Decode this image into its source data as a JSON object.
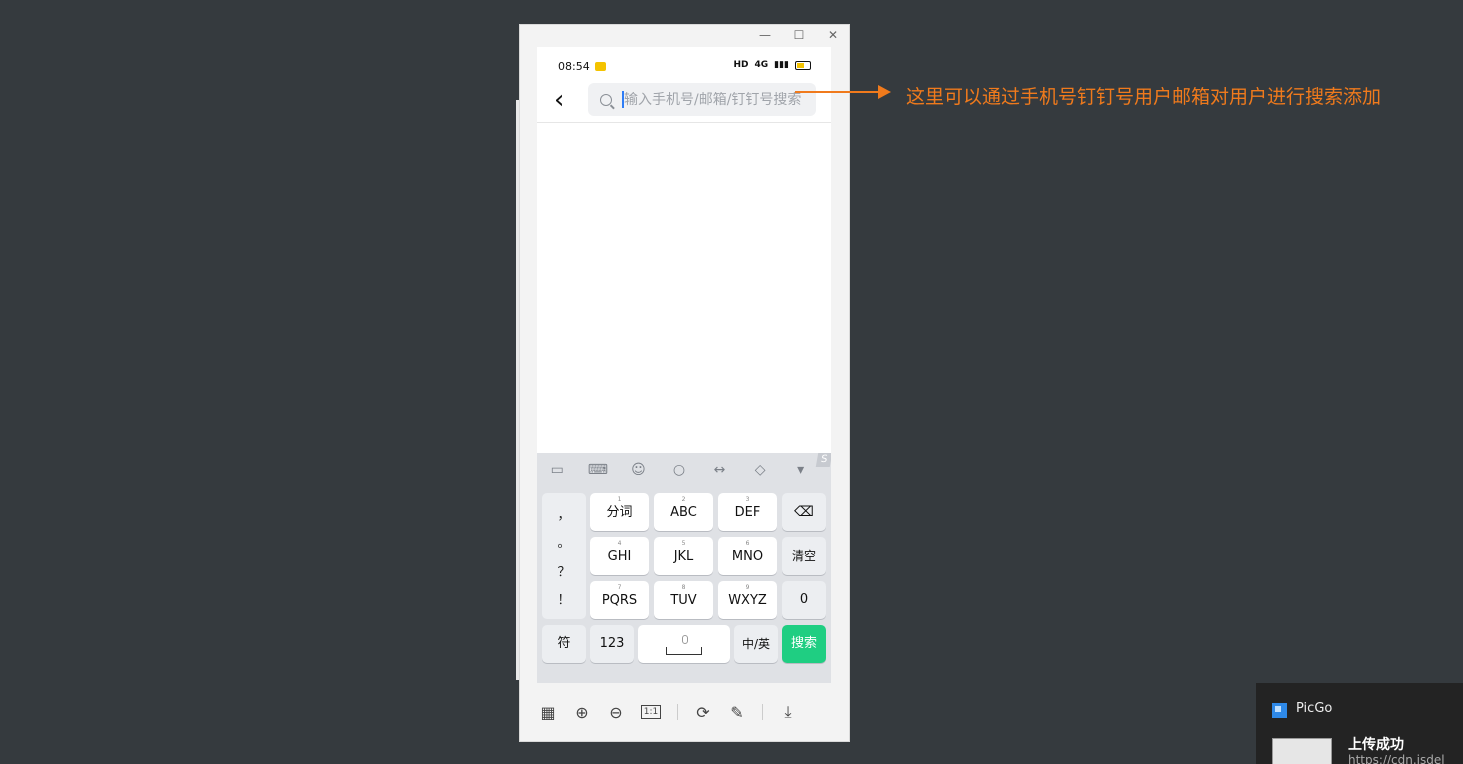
{
  "window": {
    "minimize_icon": "minimize-icon",
    "maximize_icon": "maximize-icon",
    "close_icon": "close-icon",
    "minimize": "—",
    "maximize": "☐",
    "close": "✕"
  },
  "phone": {
    "status": {
      "time": "08:54",
      "network_label": "HD",
      "signal_text": "4G"
    },
    "search": {
      "placeholder": "输入手机号/邮箱/钉钉号搜索"
    },
    "keyboard": {
      "toolbar_icons": [
        "clipboard-icon",
        "keyboard-icon",
        "emoji-icon",
        "search-icon",
        "cursor-icon",
        "skin-icon",
        "collapse-icon"
      ],
      "punctuation": [
        "，",
        "。",
        "？",
        "！"
      ],
      "rows": [
        [
          {
            "num": "1",
            "label": "分词"
          },
          {
            "num": "2",
            "label": "ABC"
          },
          {
            "num": "3",
            "label": "DEF"
          }
        ],
        [
          {
            "num": "4",
            "label": "GHI"
          },
          {
            "num": "5",
            "label": "JKL"
          },
          {
            "num": "6",
            "label": "MNO"
          }
        ],
        [
          {
            "num": "7",
            "label": "PQRS"
          },
          {
            "num": "8",
            "label": "TUV"
          },
          {
            "num": "9",
            "label": "WXYZ"
          }
        ]
      ],
      "clear": "清空",
      "zero": "0",
      "symbols": "符",
      "numbers": "123",
      "lang_switch": "中/英",
      "search_key": "搜索"
    }
  },
  "viewer_toolbar": [
    "grid-icon",
    "zoom-in-icon",
    "zoom-out-icon",
    "actual-size-icon",
    "rotate-icon",
    "edit-icon",
    "download-icon"
  ],
  "viewer_toolbar_one_to_one": "1:1",
  "annotation": {
    "text": "这里可以通过手机号钉钉号用户邮箱对用户进行搜索添加",
    "color": "#f07a1c"
  },
  "toast": {
    "app": "PicGo",
    "title": "上传成功",
    "url": "https://cdn.jsdel"
  }
}
